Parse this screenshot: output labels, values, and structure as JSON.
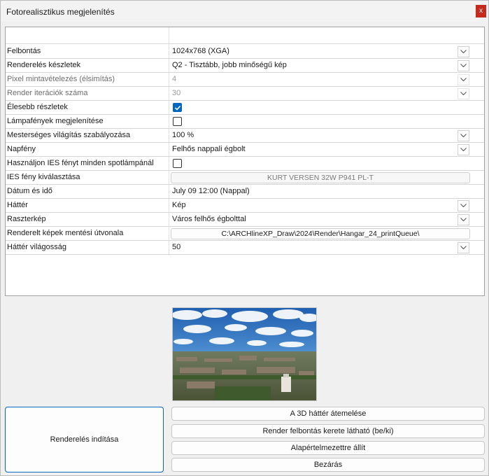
{
  "window": {
    "title": "Fotorealisztikus megjelenítés",
    "close_label": "x"
  },
  "properties": [
    {
      "label": "Felbontás",
      "type": "dropdown",
      "value": "1024x768  (XGA)"
    },
    {
      "label": "Renderelés készletek",
      "type": "dropdown",
      "value": "Q2 - Tisztább, jobb minőségű kép"
    },
    {
      "label": "Pixel mintavételezés (élsimítás)",
      "type": "dropdown",
      "value": "4",
      "disabled": true
    },
    {
      "label": "Render iterációk száma",
      "type": "dropdown",
      "value": "30",
      "disabled": true
    },
    {
      "label": "Élesebb részletek",
      "type": "checkbox",
      "checked": true
    },
    {
      "label": "Lámpafények megjelenítése",
      "type": "checkbox",
      "checked": false
    },
    {
      "label": "Mesterséges világítás szabályozása",
      "type": "dropdown",
      "value": "100 %"
    },
    {
      "label": "Napfény",
      "type": "dropdown",
      "value": "Felhős nappali égbolt"
    },
    {
      "label": "Használjon IES fényt minden spotlámpánál",
      "type": "checkbox",
      "checked": false
    },
    {
      "label": "IES fény kiválasztása",
      "type": "button",
      "value": "KURT VERSEN 32W P941 PL-T",
      "dim": true
    },
    {
      "label": "Dátum és idő",
      "type": "text",
      "value": "July 09 12:00  (Nappal)"
    },
    {
      "label": "Háttér",
      "type": "dropdown",
      "value": "Kép"
    },
    {
      "label": "Raszterkép",
      "type": "dropdown",
      "value": "Város felhős égbolttal"
    },
    {
      "label": "Renderelt képek mentési útvonala",
      "type": "button",
      "value": "C:\\ARCHlineXP_Draw\\2024\\Render\\Hangar_24_printQueue\\"
    },
    {
      "label": "Háttér világosság",
      "type": "dropdown",
      "value": "50"
    }
  ],
  "buttons": {
    "render": "Renderelés indítása",
    "transfer_background": "A 3D háttér átemelése",
    "toggle_frame": "Render felbontás kerete látható (be/ki)",
    "reset_default": "Alapértelmezettre állít",
    "close": "Bezárás"
  },
  "colors": {
    "accent": "#0067c0",
    "close_red": "#c42b1c"
  }
}
